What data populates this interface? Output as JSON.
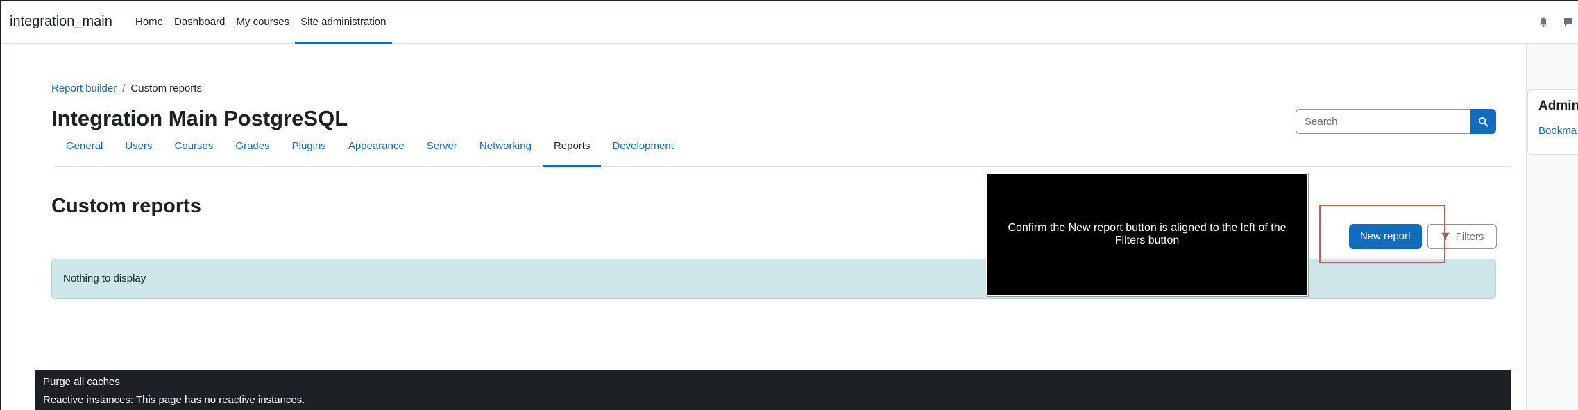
{
  "navbar": {
    "brand": "integration_main",
    "items": [
      {
        "label": "Home"
      },
      {
        "label": "Dashboard"
      },
      {
        "label": "My courses"
      },
      {
        "label": "Site administration"
      }
    ]
  },
  "breadcrumb": {
    "items": [
      {
        "label": "Report builder"
      },
      {
        "label": "Custom reports"
      }
    ],
    "separator": "/"
  },
  "page": {
    "title": "Integration Main PostgreSQL"
  },
  "search": {
    "placeholder": "Search"
  },
  "admin_tabs": [
    {
      "label": "General"
    },
    {
      "label": "Users"
    },
    {
      "label": "Courses"
    },
    {
      "label": "Grades"
    },
    {
      "label": "Plugins"
    },
    {
      "label": "Appearance"
    },
    {
      "label": "Server"
    },
    {
      "label": "Networking"
    },
    {
      "label": "Reports"
    },
    {
      "label": "Development"
    }
  ],
  "active_tab": "Reports",
  "content": {
    "heading": "Custom reports",
    "new_report_label": "New report",
    "filters_label": "Filters",
    "empty_message": "Nothing to display"
  },
  "annotation": {
    "text": "Confirm the New report button is aligned to the left of the Filters button"
  },
  "footer": {
    "purge_link": "Purge all caches",
    "reactive_text": "Reactive instances: This page has no reactive instances."
  },
  "drawer": {
    "title": "Admin",
    "link": "Bookma"
  },
  "colors": {
    "primary": "#0f6cbf",
    "alert_info_bg": "#cce6ea",
    "footer_bg": "#1d2125",
    "highlight": "#d9534f"
  },
  "icons": {
    "notifications": "bell-icon",
    "messages": "chat-icon",
    "search": "search-icon",
    "filter": "funnel-icon"
  }
}
